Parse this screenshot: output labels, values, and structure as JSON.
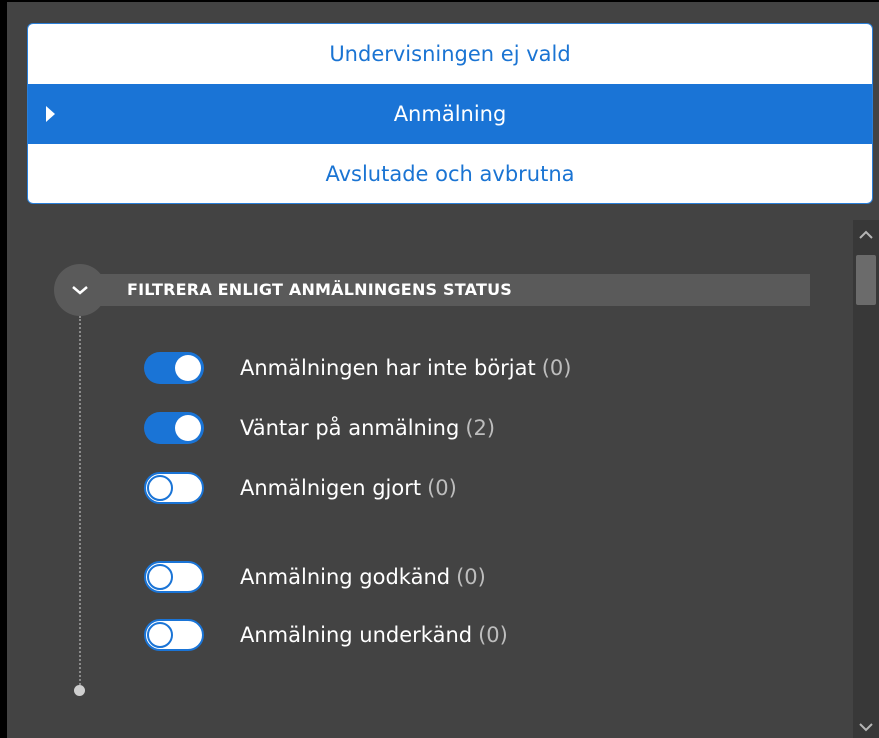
{
  "tabs": [
    {
      "label": "Undervisningen ej vald",
      "selected": false
    },
    {
      "label": "Anmälning",
      "selected": true
    },
    {
      "label": "Avslutade och avbrutna",
      "selected": false
    }
  ],
  "filter": {
    "title": "FILTRERA ENLIGT ANMÄLNINGENS STATUS",
    "expanded": true,
    "items": [
      {
        "label": "Anmälningen har inte börjat",
        "count": "(0)",
        "on": true
      },
      {
        "label": "Väntar på anmälning",
        "count": "(2)",
        "on": true
      },
      {
        "label": "Anmälnigen gjort",
        "count": "(0)",
        "on": false
      },
      {
        "label": "Anmälning godkänd",
        "count": "(0)",
        "on": false
      },
      {
        "label": "Anmälning underkänd",
        "count": "(0)",
        "on": false
      }
    ]
  },
  "icons": {
    "selected_tab": "caret-right-icon",
    "collapse": "chevron-down-icon",
    "scroll_up": "chevron-up-icon",
    "scroll_down": "chevron-down-icon"
  },
  "colors": {
    "accent": "#1a74d6",
    "panel_bg": "#434343",
    "header_bar": "#5a5a5a",
    "muted_text": "#bdbdbd"
  }
}
